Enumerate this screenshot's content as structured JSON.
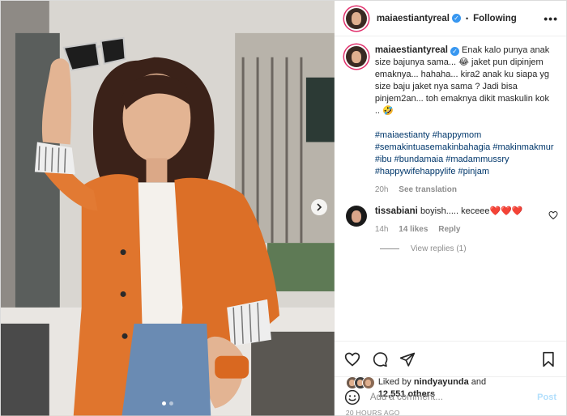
{
  "header": {
    "username": "maiaestiantyreal",
    "separator": "•",
    "follow_label": "Following",
    "more_label": "•••"
  },
  "caption": {
    "username": "maiaestiantyreal",
    "text": "Enak kalo punya anak size bajunya sama... 😂 jaket pun dipinjem emaknya... hahaha... kira2 anak ku siapa yg size baju jaket nya sama ? Jadi bisa pinjem2an... toh emaknya dikit maskulin kok .. 🤣",
    "hashtags": "#maiaestianty #happymom #semakintuasemakinbahagia #makinmakmur #ibu #bundamaia #madammussry #happywifehappylife #pinjam",
    "time": "20h",
    "translate_label": "See translation"
  },
  "comment": {
    "username": "tissabiani",
    "text": "boyish..... keceee❤️❤️❤️",
    "time": "14h",
    "likes": "14 likes",
    "reply_label": "Reply",
    "view_replies": "View replies (1)"
  },
  "likes": {
    "prefix": "Liked by",
    "user": "nindyayunda",
    "joiner": "and",
    "count": "12,551 others"
  },
  "timestamp": "20 HOURS AGO",
  "add_comment": {
    "placeholder": "Add a comment...",
    "post_label": "Post"
  },
  "colors": {
    "link": "#00376b",
    "verified": "#3897f0",
    "muted": "#8e8e8e",
    "post_disabled": "#b2dffc",
    "blazer": "#e0752d"
  },
  "icons": {
    "next": "chevron-right-icon",
    "like": "heart-icon",
    "comment": "comment-icon",
    "share": "send-icon",
    "save": "bookmark-icon",
    "emoji": "emoji-icon"
  },
  "carousel": {
    "count": 2,
    "active": 1
  }
}
